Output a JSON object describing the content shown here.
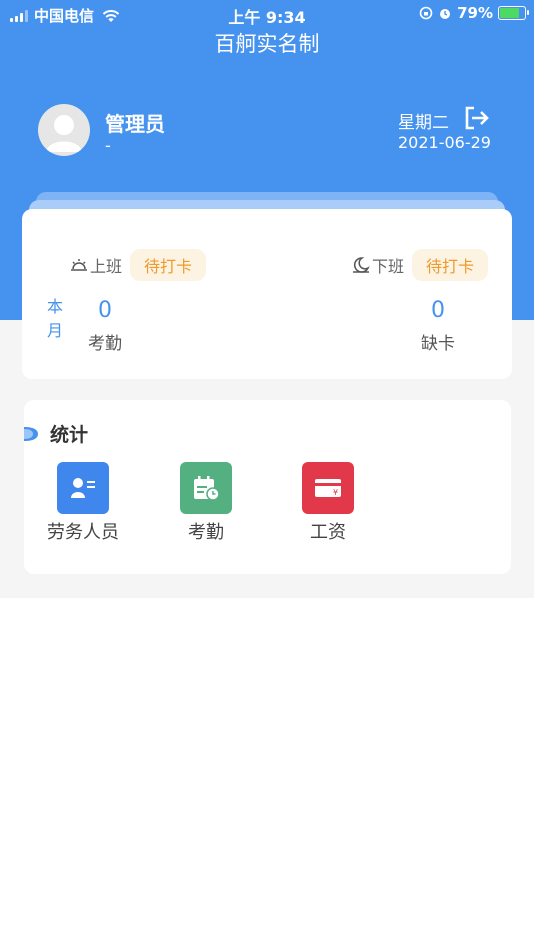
{
  "status_bar": {
    "carrier": "中国电信",
    "time": "上午 9:34",
    "battery": "79%",
    "battery_level": 0.79
  },
  "app": {
    "title": "百舸实名制"
  },
  "user": {
    "name": "管理员",
    "subtitle": "-",
    "weekday": "星期二",
    "date": "2021-06-29"
  },
  "attendance": {
    "on_duty": {
      "label": "上班",
      "status": "待打卡"
    },
    "off_duty": {
      "label": "下班",
      "status": "待打卡"
    },
    "month_label": "本月",
    "attend": {
      "value": "0",
      "label": "考勤"
    },
    "missing": {
      "value": "0",
      "label": "缺卡"
    }
  },
  "stats": {
    "title": "统计",
    "items": [
      {
        "label": "劳务人员",
        "icon": "personnel-icon",
        "color": "#3f87ec"
      },
      {
        "label": "考勤",
        "icon": "calendar-clock-icon",
        "color": "#54b081"
      },
      {
        "label": "工资",
        "icon": "salary-card-icon",
        "color": "#e2394a"
      }
    ]
  },
  "colors": {
    "primary": "#4593ef",
    "pending_bg": "#fdf3e3",
    "pending_text": "#ee9a2c"
  }
}
